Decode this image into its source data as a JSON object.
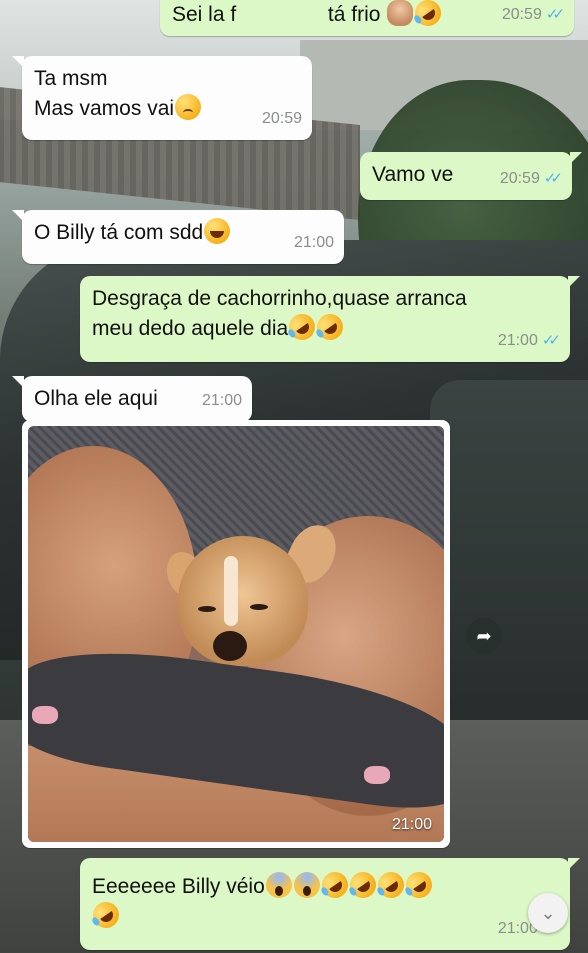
{
  "messages": [
    {
      "id": "m0",
      "direction": "out",
      "text": "Sei la f",
      "text2": "tá frio",
      "time": "20:59"
    },
    {
      "id": "m1",
      "direction": "in",
      "line1": "Ta msm",
      "line2": "Mas vamos vai",
      "time": "20:59"
    },
    {
      "id": "m2",
      "direction": "out",
      "text": "Vamo ve",
      "time": "20:59"
    },
    {
      "id": "m3",
      "direction": "in",
      "text": "O Billy tá com sdd",
      "time": "21:00"
    },
    {
      "id": "m4",
      "direction": "out",
      "line1": "Desgraça de cachorrinho,quase arranca",
      "line2": "meu dedo aquele dia",
      "time": "21:00"
    },
    {
      "id": "m5",
      "direction": "in",
      "text": "Olha ele aqui",
      "time": "21:00"
    },
    {
      "id": "m6",
      "direction": "in",
      "type": "photo",
      "time": "21:00"
    },
    {
      "id": "m7",
      "direction": "out",
      "text": "Eeeeeee Billy véio",
      "time": "21:00"
    }
  ],
  "read_receipt": "✓✓",
  "icons": {
    "forward": "forward-arrow-icon",
    "scroll_down": "chevron-double-down-icon"
  },
  "colors": {
    "incoming_bubble": "#fdfdfd",
    "outgoing_bubble": "#dcf8c6",
    "read_ticks": "#4fb6ec",
    "timestamp": "#8a8f8a"
  }
}
